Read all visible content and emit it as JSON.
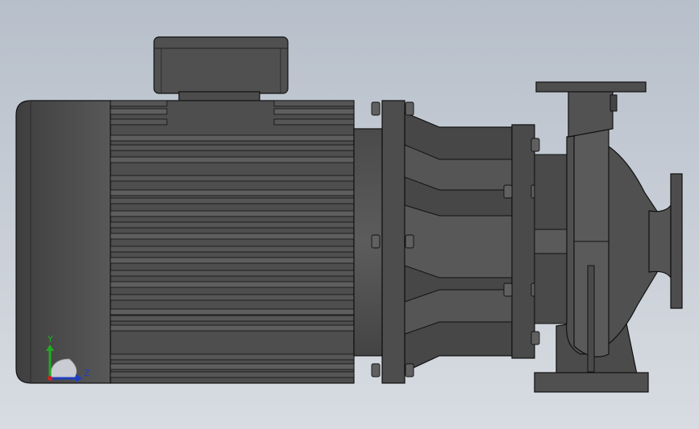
{
  "viewport": {
    "background_top": "#b7bfca",
    "background_bottom": "#d8dce2",
    "model_fill": "#555555",
    "model_dark": "#3a3a3a",
    "model_light": "#6a6a6a",
    "edge_color": "#111111"
  },
  "model": {
    "subject": "centrifugal-pump-with-motor",
    "parts": [
      "motor-body",
      "terminal-box",
      "motor-end-cap",
      "lantern-bracket",
      "pump-casing",
      "suction-flange",
      "discharge-flange",
      "pump-foot"
    ]
  },
  "triad": {
    "y_label": "Y",
    "z_label": "Z",
    "y_color": "#22aa22",
    "z_color": "#1f3fc0",
    "x_color": "#cc2222"
  }
}
